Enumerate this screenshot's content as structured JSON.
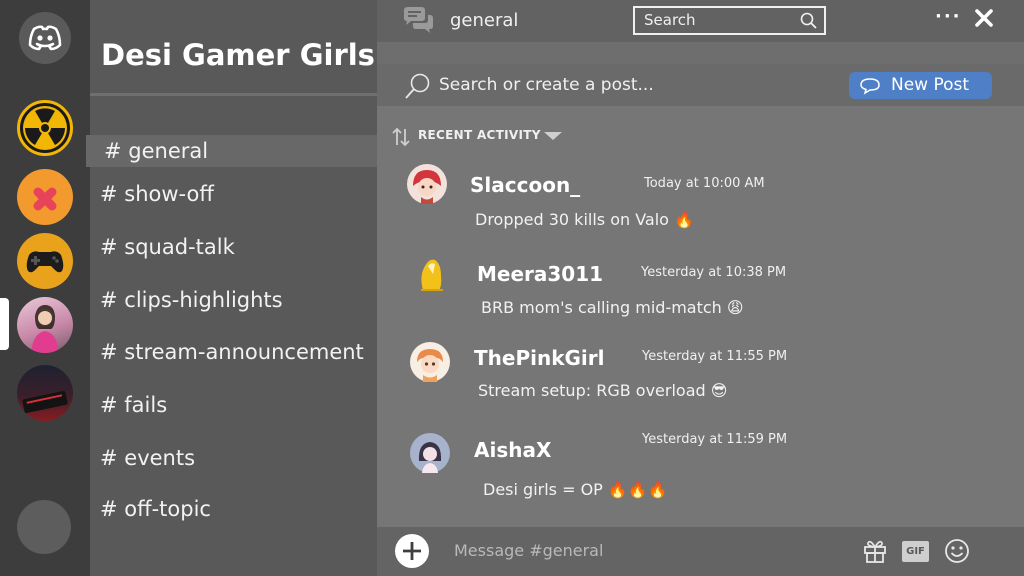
{
  "rail": {
    "home_icon": "discord-logo-icon",
    "servers": [
      {
        "name": "radiation-server-icon"
      },
      {
        "name": "orange-x-server-icon"
      },
      {
        "name": "controller-server-icon"
      },
      {
        "name": "girl-gamer-server-icon"
      },
      {
        "name": "keyboard-server-icon"
      }
    ]
  },
  "server": {
    "title": "Desi Gamer Girls",
    "channels": [
      {
        "label": "# general",
        "active": true
      },
      {
        "label": "# show-off"
      },
      {
        "label": "# squad-talk"
      },
      {
        "label": "# clips-highlights"
      },
      {
        "label": "# stream-announcement"
      },
      {
        "label": "# fails"
      },
      {
        "label": "# events"
      },
      {
        "label": "# off-topic"
      }
    ]
  },
  "header": {
    "channel": "general",
    "search_label": "Search",
    "more_icon": "more-dots-icon",
    "close_icon": "close-icon"
  },
  "forum": {
    "search_placeholder": "Search or create a post...",
    "new_post_label": "New Post",
    "sort_label": "RECENT ACTIVITY"
  },
  "messages": [
    {
      "user": "Slaccoon_",
      "time": "Today at 10:00 AM",
      "text": "Dropped 30 kills on Valo 🔥"
    },
    {
      "user": "Meera3011",
      "time": "Yesterday at 10:38 PM",
      "text": "BRB mom's calling mid-match 😩"
    },
    {
      "user": "ThePinkGirl",
      "time": "Yesterday at 11:55 PM",
      "text": "Stream setup: RGB overload 😎"
    },
    {
      "user": "AishaX",
      "time": "Yesterday at 11:59 PM",
      "text": "Desi girls = OP 🔥🔥🔥"
    }
  ],
  "composer": {
    "placeholder": "Message #general",
    "gif_label": "GIF"
  },
  "colors": {
    "accent": "#4f7fc6",
    "rail_bg": "#3d3d3d",
    "channel_bg": "#595959",
    "main_bg": "#767676"
  }
}
